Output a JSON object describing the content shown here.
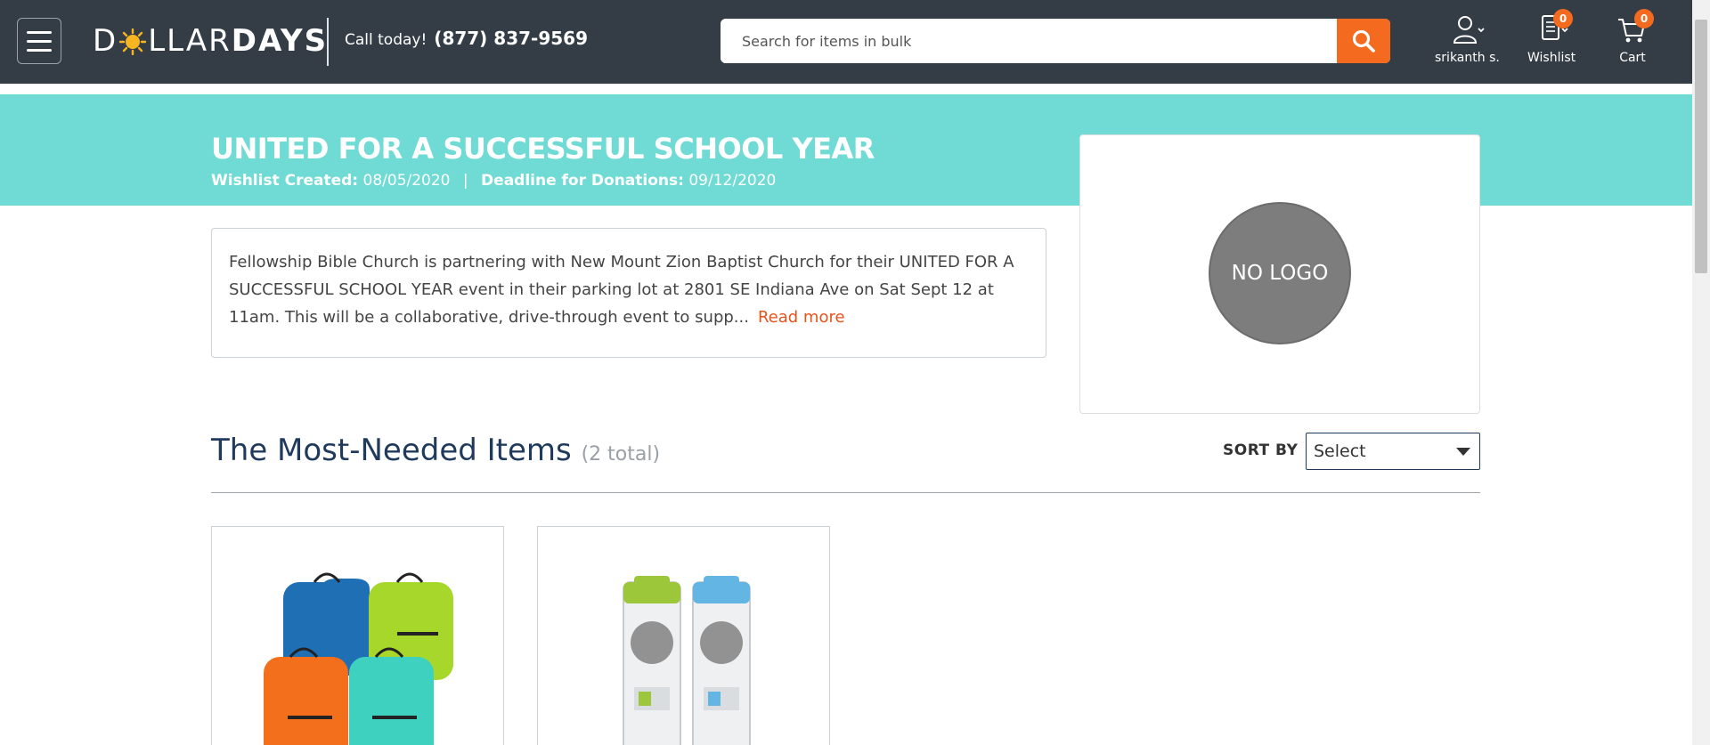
{
  "header": {
    "logo": {
      "part1": "D",
      "part2": "LLAR",
      "part3": "DAYS"
    },
    "call_label": "Call today!",
    "phone": "(877) 837-9569",
    "search_placeholder": "Search for items in bulk",
    "account_label": "srikanth s.",
    "wishlist_label": "Wishlist",
    "wishlist_count": "0",
    "cart_label": "Cart",
    "cart_count": "0"
  },
  "wishlist": {
    "title": "UNITED FOR A SUCCESSFUL SCHOOL YEAR",
    "created_label": "Wishlist Created:",
    "created_date": "08/05/2020",
    "separator": "|",
    "deadline_label": "Deadline for Donations:",
    "deadline_date": "09/12/2020",
    "logo_text": "NO LOGO",
    "description": "Fellowship Bible Church is partnering with New Mount Zion Baptist Church for their UNITED FOR A SUCCESSFUL SCHOOL YEAR event in their parking lot at 2801 SE Indiana Ave on Sat Sept 12 at 11am. This will be a collaborative, drive-through event to supp...",
    "read_more": "Read more"
  },
  "items_section": {
    "heading": "The Most-Needed Items",
    "count": "(2 total)",
    "sort_label": "SORT BY",
    "sort_value": "Select"
  },
  "products": [
    {
      "name": "backpacks-image",
      "colors": [
        "#1f6fb5",
        "#a6d72a",
        "#f36f1c",
        "#3fd1c0"
      ]
    },
    {
      "name": "water-bottles-image",
      "colors": [
        "#9cc73a",
        "#63b6e3"
      ]
    }
  ],
  "colors": {
    "header_bg": "#343d46",
    "accent_orange": "#f46a1e",
    "banner_teal": "#6fdbd4",
    "heading_navy": "#1f3a5c"
  }
}
